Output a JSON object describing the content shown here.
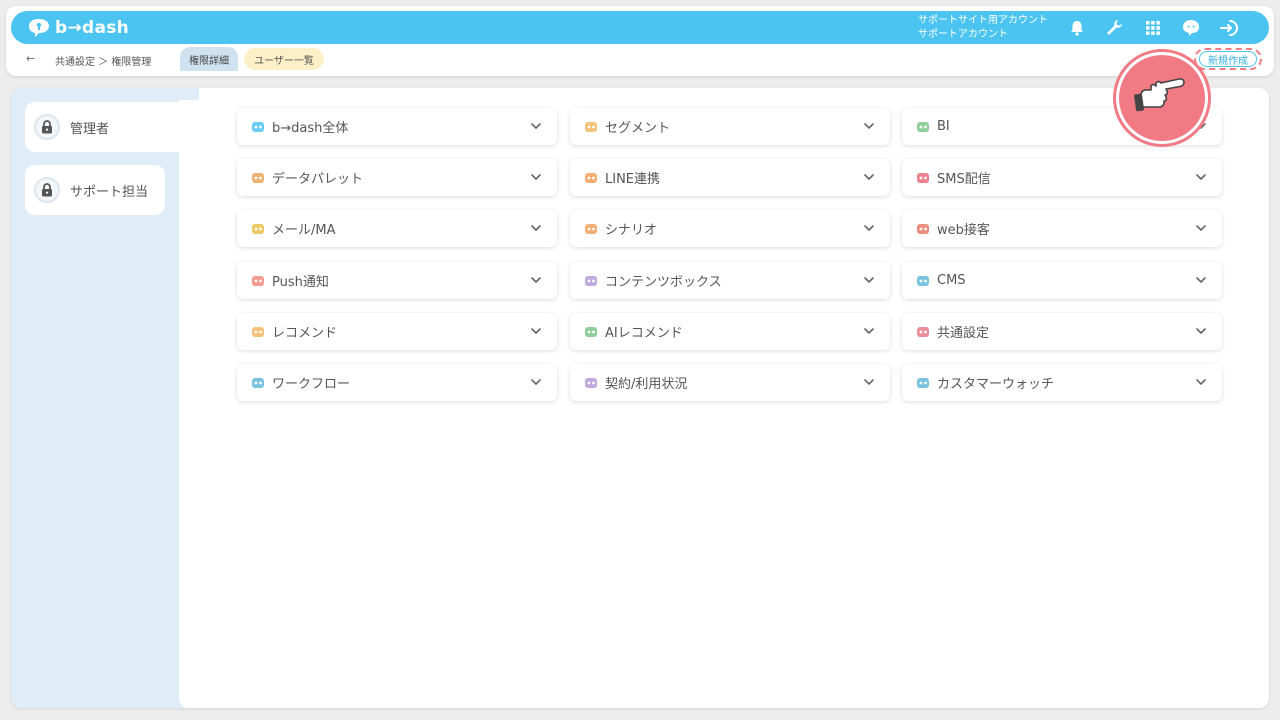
{
  "header": {
    "logo_text": "b→dash",
    "account_line1": "サポートサイト用アカウント",
    "account_line2": "サポートアカウント",
    "brand_color": "#4cc4f2"
  },
  "subnav": {
    "back": "←",
    "breadcrumb": "共通設定 ＞ 権限管理",
    "tab_detail": "権限詳細",
    "tab_users": "ユーザー一覧",
    "new_button": "新規作成"
  },
  "roles": [
    {
      "label": "管理者",
      "active": true
    },
    {
      "label": "サポート担当",
      "active": false
    }
  ],
  "modules": [
    {
      "label": "b→dash全体",
      "icon": "bdash-logo-icon"
    },
    {
      "label": "セグメント",
      "icon": "segment-icon"
    },
    {
      "label": "BI",
      "icon": "bi-chart-icon"
    },
    {
      "label": "データパレット",
      "icon": "palette-icon"
    },
    {
      "label": "LINE連携",
      "icon": "line-icon"
    },
    {
      "label": "SMS配信",
      "icon": "sms-icon"
    },
    {
      "label": "メール/MA",
      "icon": "mail-icon"
    },
    {
      "label": "シナリオ",
      "icon": "scenario-icon"
    },
    {
      "label": "web接客",
      "icon": "web-icon"
    },
    {
      "label": "Push通知",
      "icon": "push-icon"
    },
    {
      "label": "コンテンツボックス",
      "icon": "contents-box-icon"
    },
    {
      "label": "CMS",
      "icon": "cms-icon"
    },
    {
      "label": "レコメンド",
      "icon": "recommend-icon"
    },
    {
      "label": "AIレコメンド",
      "icon": "ai-recommend-icon"
    },
    {
      "label": "共通設定",
      "icon": "settings-icon"
    },
    {
      "label": "ワークフロー",
      "icon": "workflow-icon"
    },
    {
      "label": "契約/利用状況",
      "icon": "contract-icon"
    },
    {
      "label": "カスタマーウォッチ",
      "icon": "customer-watch-icon"
    }
  ]
}
